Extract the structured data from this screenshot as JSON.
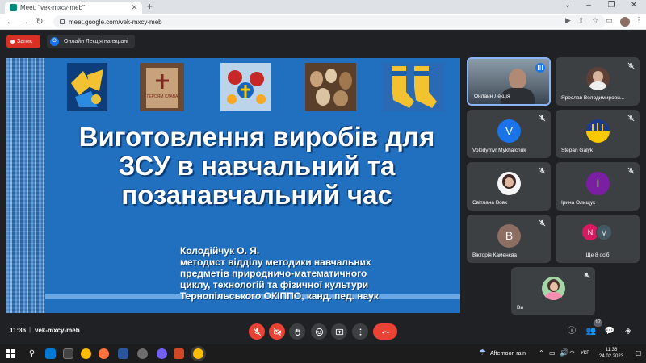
{
  "browser": {
    "tab_title": "Meet: \"vek-mxcy-meb\"",
    "url": "meet.google.com/vek-mxcy-meb"
  },
  "meet_header": {
    "record_label": "Запис",
    "presenting_label": "Онлайн Лекція на екрані"
  },
  "slide": {
    "title": "Виготовлення виробів для ЗСУ в навчальний та позанавчальний час",
    "author_line1": "Колодійчук О. Я.",
    "author_line2": "методист відділу методики навчальних",
    "author_line3": "предметів природничо-математичного",
    "author_line4": "циклу, технологій та фізичної культури",
    "author_line5": "Тернопільського ОКІППО, канд. пед. наук",
    "book_cover_text": "ГЕРОЯМ СЛАВА"
  },
  "participants": [
    {
      "name": "Онлайн Лекція",
      "avatar_letter": "",
      "avatar_color": "",
      "speaking": true
    },
    {
      "name": "Ярослав Володимирови...",
      "avatar_letter": "",
      "avatar_color": "#5d4037"
    },
    {
      "name": "Volodymyr Mykhalchuk",
      "avatar_letter": "V",
      "avatar_color": "#1a73e8"
    },
    {
      "name": "Stepan Galyk",
      "avatar_letter": "",
      "avatar_color": "#1e3a8a"
    },
    {
      "name": "Світлана Вовк",
      "avatar_letter": "",
      "avatar_color": "#f5f5f5"
    },
    {
      "name": "Ірина Олищук",
      "avatar_letter": "І",
      "avatar_color": "#7b1fa2"
    },
    {
      "name": "Вікторія Каменєва",
      "avatar_letter": "В",
      "avatar_color": "#8d6e63"
    },
    {
      "name": "Ще 8 осіб",
      "avatar_letter": "",
      "avatar_color": "",
      "extra_letters": [
        "N",
        "M"
      ]
    },
    {
      "name": "Ви",
      "avatar_letter": "",
      "avatar_color": "#a5d6a7"
    }
  ],
  "bottom_bar": {
    "time": "11:36",
    "separator": "|",
    "meeting_code": "vek-mxcy-meb",
    "people_count": "17"
  },
  "taskbar": {
    "weather": "Afternoon rain",
    "language": "УКР",
    "clock_time": "11:36",
    "clock_date": "24.02.2023"
  },
  "colors": {
    "end_call": "#ea4335",
    "muted": "#ea4335",
    "active_speaker_border": "#8ab4f8",
    "meet_bg": "#202124",
    "slide_bg": "#2170c0"
  }
}
